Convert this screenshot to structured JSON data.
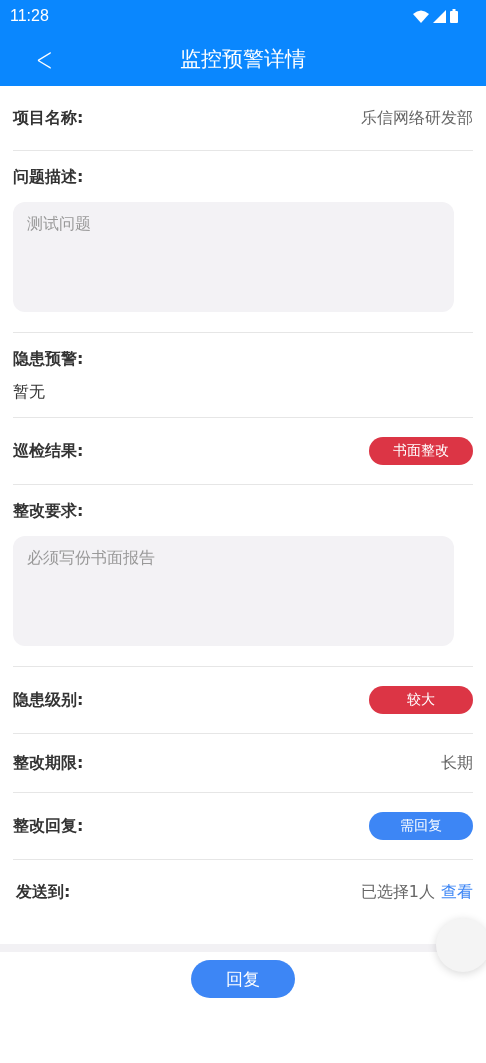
{
  "status_bar": {
    "time": "11:28"
  },
  "header": {
    "back": "<",
    "title": "监控预警详情"
  },
  "fields": [
    {
      "kind": "value",
      "label": "项目名称:",
      "value": "乐信网络研发部"
    },
    {
      "kind": "textarea",
      "label": "问题描述:",
      "value": "测试问题"
    },
    {
      "kind": "text",
      "label": "隐患预警:",
      "value": "暂无"
    },
    {
      "kind": "tag",
      "label": "巡检结果:",
      "value": "书面整改",
      "color": "#dc3545"
    },
    {
      "kind": "textarea",
      "label": "整改要求:",
      "value": "必须写份书面报告"
    },
    {
      "kind": "tag",
      "label": "隐患级别:",
      "value": "较大",
      "color": "#dc3545"
    },
    {
      "kind": "value",
      "label": "整改期限:",
      "value": "长期"
    },
    {
      "kind": "tag",
      "label": "整改回复:",
      "value": "需回复",
      "color": "#3d86f5"
    },
    {
      "kind": "link",
      "label": "发送到:",
      "value": "已选择1人",
      "link": "查看"
    }
  ],
  "footer": {
    "button": "回复"
  }
}
